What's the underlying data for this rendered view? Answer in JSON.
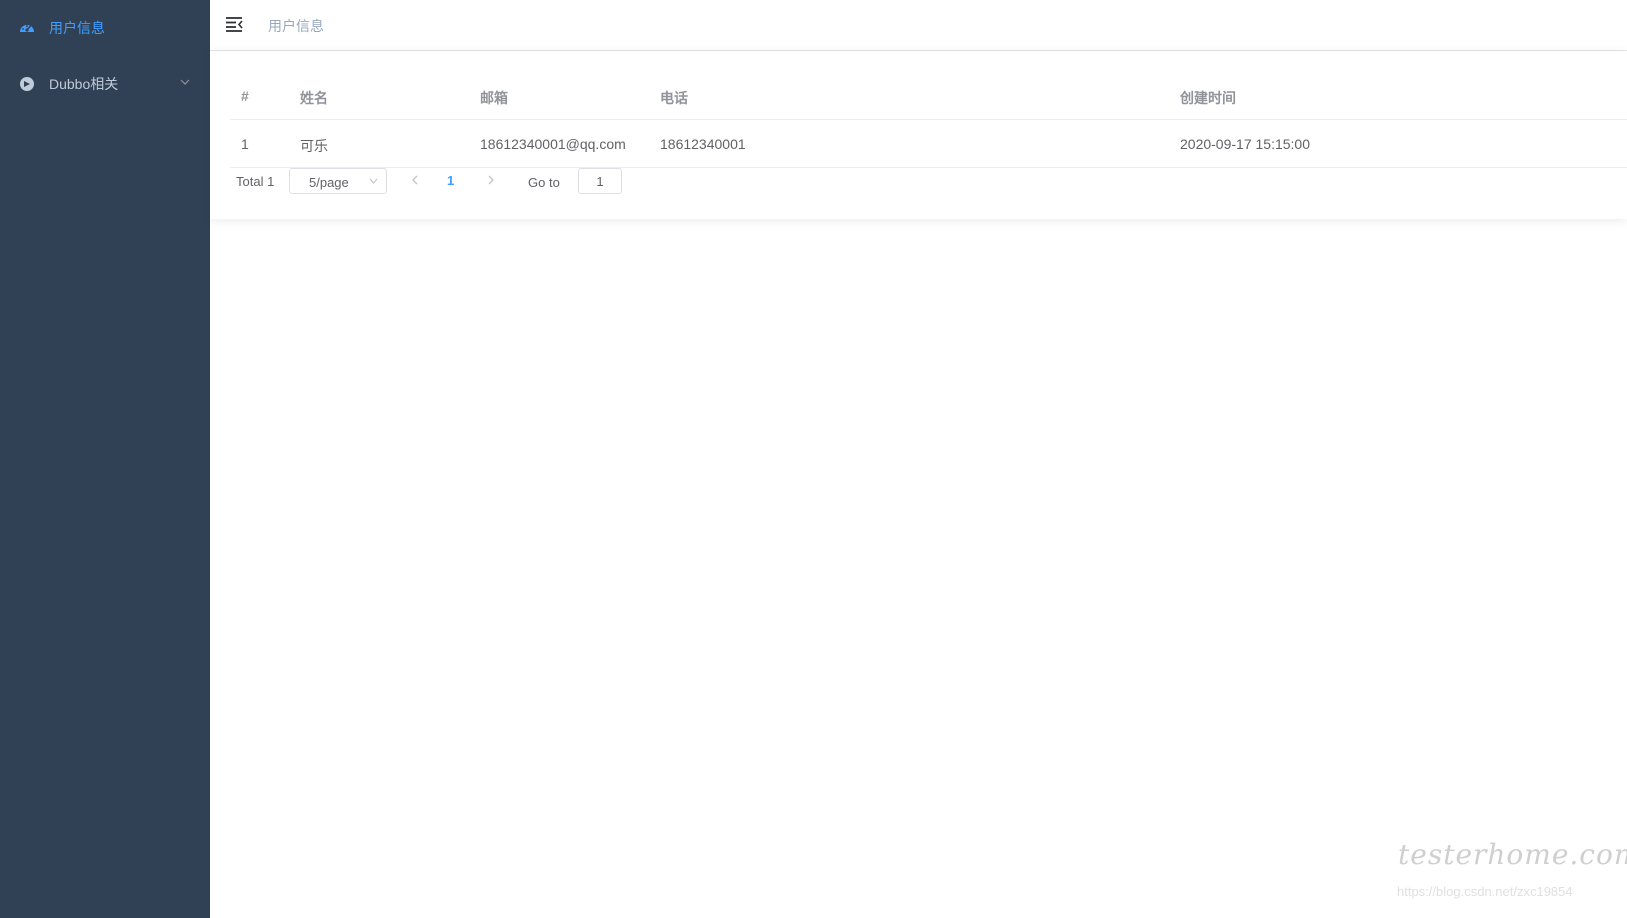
{
  "sidebar": {
    "items": [
      {
        "label": "用户信息",
        "icon": "dashboard-icon",
        "active": true
      },
      {
        "label": "Dubbo相关",
        "icon": "component-icon",
        "active": false,
        "has_submenu": true
      }
    ]
  },
  "navbar": {
    "hamburger_icon": "hamburger-icon",
    "breadcrumb": "用户信息"
  },
  "table": {
    "headers": [
      "#",
      "姓名",
      "邮箱",
      "电话",
      "创建时间"
    ],
    "rows": [
      [
        "1",
        "可乐",
        "18612340001@qq.com",
        "18612340001",
        "2020-09-17 15:15:00"
      ]
    ]
  },
  "pagination": {
    "total_label": "Total 1",
    "page_size": "5/page",
    "current_page": "1",
    "goto_label": "Go to",
    "goto_value": "1"
  },
  "watermark": {
    "text": "testerhome.com",
    "url": "https://blog.csdn.net/zxc19854"
  },
  "colors": {
    "sidebar_bg": "#304156",
    "accent": "#409eff",
    "sidebar_text": "#bfcbd9"
  }
}
